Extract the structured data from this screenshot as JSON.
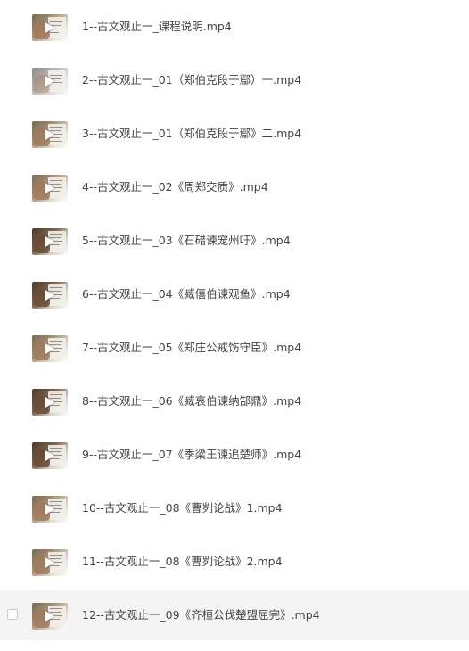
{
  "files": [
    {
      "name": "1--古文观止一_课程说明.mp4",
      "thumb": "video-thumbnail",
      "hovered": false
    },
    {
      "name": "2--古文观止一_01（郑伯克段于鄢）一.mp4",
      "thumb": "video-thumbnail",
      "hovered": false
    },
    {
      "name": "3--古文观止一_01（郑伯克段于鄢》二.mp4",
      "thumb": "video-thumbnail",
      "hovered": false
    },
    {
      "name": "4--古文观止一_02《周郑交质》.mp4",
      "thumb": "video-thumbnail",
      "hovered": false
    },
    {
      "name": "5--古文观止一_03《石碏谏宠州吁》.mp4",
      "thumb": "video-thumbnail",
      "hovered": false
    },
    {
      "name": "6--古文观止一_04《臧僖伯谏观鱼》.mp4",
      "thumb": "video-thumbnail",
      "hovered": false
    },
    {
      "name": "7--古文观止一_05《郑庄公戒饬守臣》.mp4",
      "thumb": "video-thumbnail",
      "hovered": false
    },
    {
      "name": "8--古文观止一_06《臧哀伯谏纳郜鼎》.mp4",
      "thumb": "video-thumbnail",
      "hovered": false
    },
    {
      "name": "9--古文观止一_07《季梁王谏追楚师》.mp4",
      "thumb": "video-thumbnail",
      "hovered": false
    },
    {
      "name": "10--古文观止一_08《曹刿论战》1.mp4",
      "thumb": "video-thumbnail",
      "hovered": false
    },
    {
      "name": "11--古文观止一_08《曹刿论战》2.mp4",
      "thumb": "video-thumbnail",
      "hovered": false
    },
    {
      "name": "12--古文观止一_09《齐桓公伐楚盟屈完》.mp4",
      "thumb": "video-thumbnail",
      "hovered": true
    }
  ],
  "colors": {
    "text": "#444444",
    "hover_bg": "#f4f4f4",
    "checkbox_border": "#c8c8c8",
    "play_icon": "#ffffff"
  },
  "icons": {
    "play": "play-icon",
    "checkbox": "checkbox-icon"
  }
}
